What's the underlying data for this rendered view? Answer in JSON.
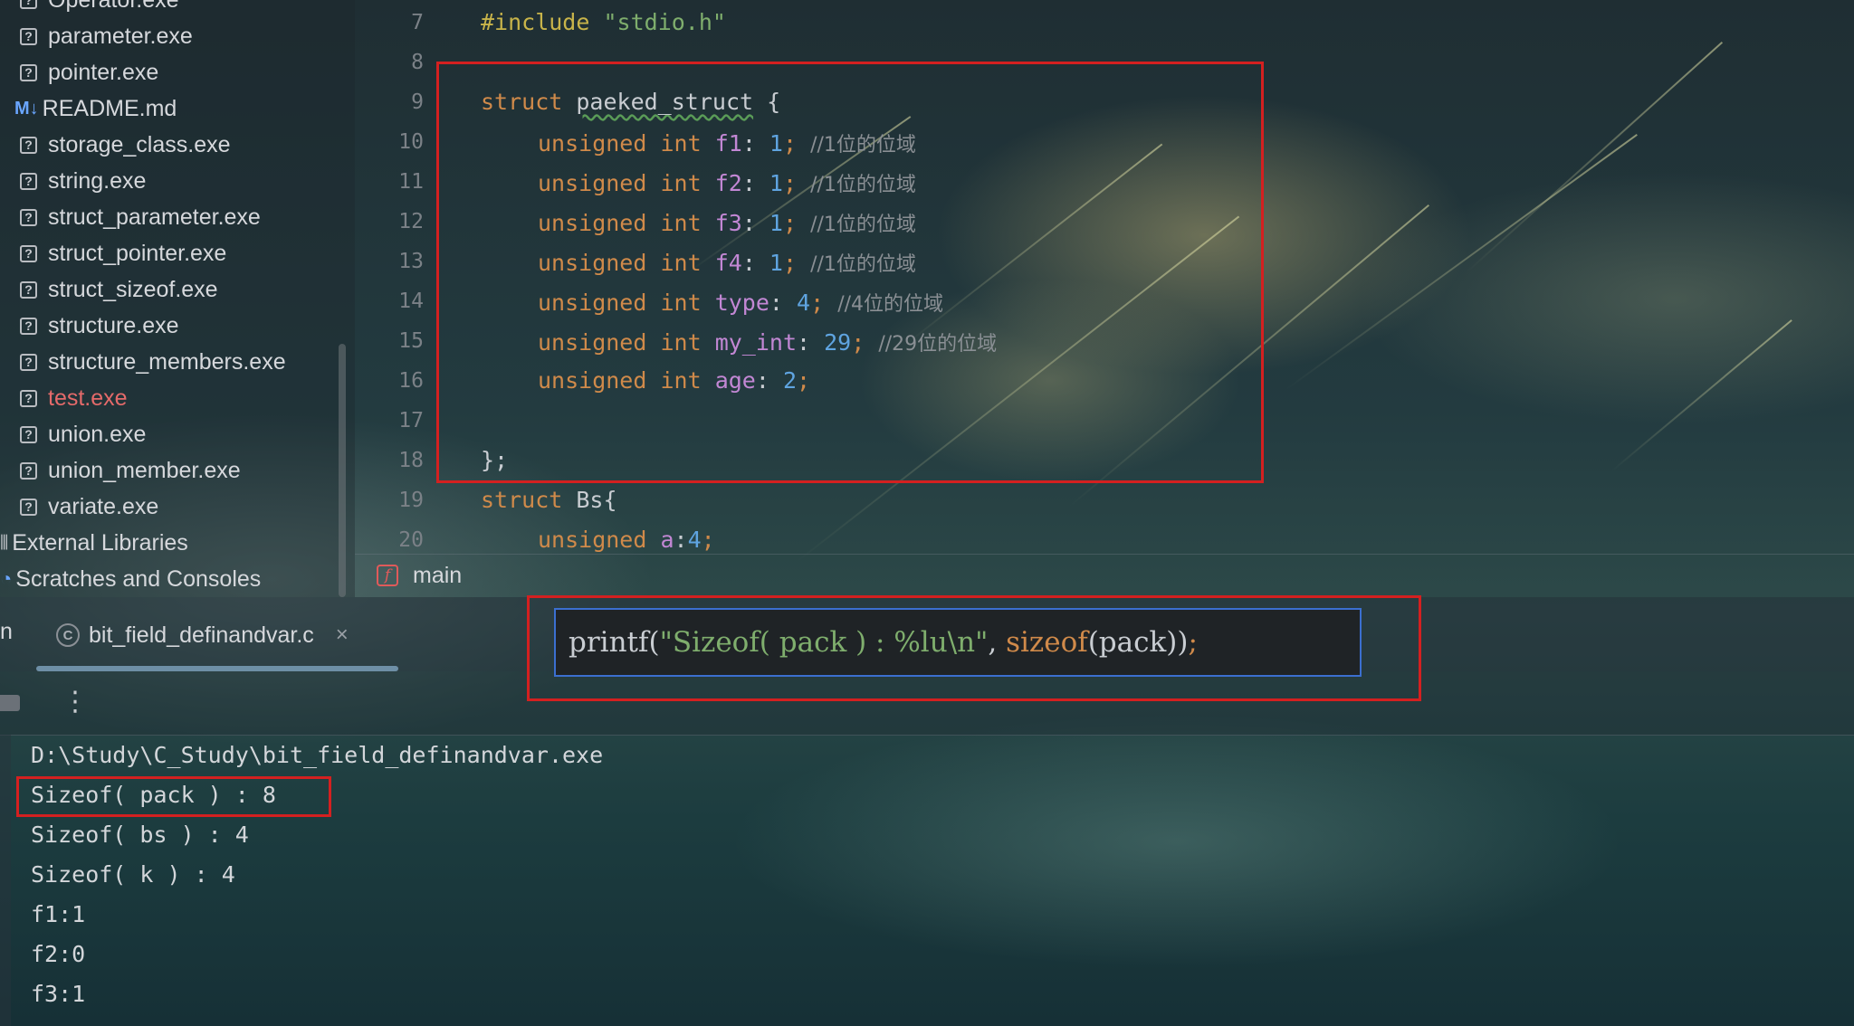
{
  "project_tree": {
    "items": [
      {
        "label": "Operator.exe",
        "icon": "question-file-icon"
      },
      {
        "label": "parameter.exe",
        "icon": "question-file-icon"
      },
      {
        "label": "pointer.exe",
        "icon": "question-file-icon"
      },
      {
        "label": "README.md",
        "icon": "markdown-icon"
      },
      {
        "label": "storage_class.exe",
        "icon": "question-file-icon"
      },
      {
        "label": "string.exe",
        "icon": "question-file-icon"
      },
      {
        "label": "struct_parameter.exe",
        "icon": "question-file-icon"
      },
      {
        "label": "struct_pointer.exe",
        "icon": "question-file-icon"
      },
      {
        "label": "struct_sizeof.exe",
        "icon": "question-file-icon"
      },
      {
        "label": "structure.exe",
        "icon": "question-file-icon"
      },
      {
        "label": "structure_members.exe",
        "icon": "question-file-icon"
      },
      {
        "label": "test.exe",
        "icon": "question-file-icon",
        "error": true
      },
      {
        "label": "union.exe",
        "icon": "question-file-icon"
      },
      {
        "label": "union_member.exe",
        "icon": "question-file-icon"
      },
      {
        "label": "variate.exe",
        "icon": "question-file-icon"
      },
      {
        "label": "External Libraries",
        "icon": "library-icon"
      },
      {
        "label": "Scratches and Consoles",
        "icon": "scratches-icon"
      }
    ],
    "markdown_icon_text": "M↓"
  },
  "editor": {
    "line_numbers": [
      "7",
      "8",
      "9",
      "10",
      "11",
      "12",
      "13",
      "14",
      "15",
      "16",
      "17",
      "18",
      "19",
      "20"
    ],
    "code": {
      "l7_directive": "#include",
      "l7_header": "\"stdio.h\"",
      "l9_kw": "struct",
      "l9_name": "paeked_struct",
      "l9_rest": " {",
      "unsigned": "unsigned",
      "int": "int",
      "fields": [
        {
          "name": "f1",
          "value": "1",
          "comment": "//1位的位域"
        },
        {
          "name": "f2",
          "value": "1",
          "comment": "//1位的位域"
        },
        {
          "name": "f3",
          "value": "1",
          "comment": "//1位的位域"
        },
        {
          "name": "f4",
          "value": "1",
          "comment": "//1位的位域"
        },
        {
          "name": "type",
          "value": "4",
          "comment": "//4位的位域"
        },
        {
          "name": "my_int",
          "value": "29",
          "comment": "//29位的位域"
        },
        {
          "name": "age",
          "value": "2",
          "comment": ""
        }
      ],
      "l18": "};",
      "l19_kw": "struct",
      "l19_rest": " Bs{",
      "l20_kw": "unsigned",
      "l20_field": "a",
      "l20_value": "4"
    },
    "breadcrumb_function": "main"
  },
  "tabs": {
    "stub_label": "n",
    "active_file": "bit_field_definandvar.c"
  },
  "popup": {
    "fn": "printf(",
    "fmt_str": "\"Sizeof( pack ) : %lu\\n\"",
    "sep": ", ",
    "sizeof_kw": "sizeof",
    "arg": "(pack))",
    "semi": ";"
  },
  "console": {
    "lines": [
      "D:\\Study\\C_Study\\bit_field_definandvar.exe",
      "Sizeof( pack ) : 8",
      "Sizeof( bs ) : 4",
      "Sizeof( k ) : 4",
      "f1:1",
      "f2:0",
      "f3:1"
    ]
  },
  "colors": {
    "highlight": "#d42020",
    "keyword": "#d08a4a",
    "string": "#7fae6d",
    "field": "#c287d4",
    "number": "#5fa4e0",
    "error_file": "#e46a6a"
  }
}
